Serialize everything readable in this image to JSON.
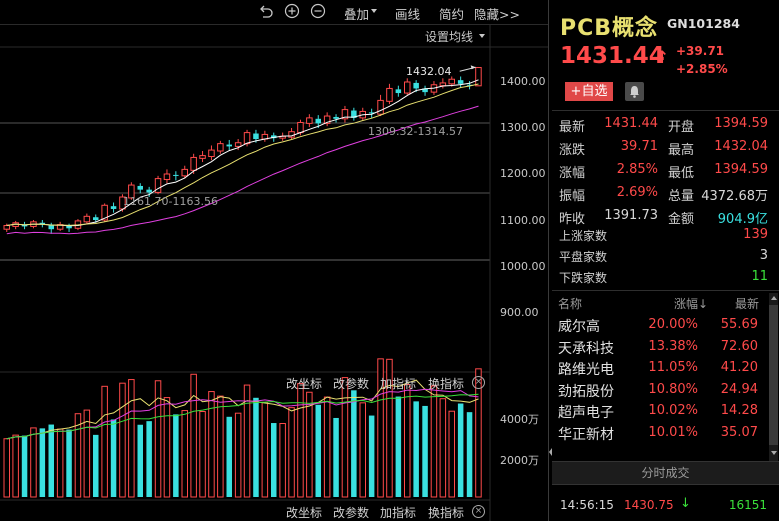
{
  "toolbar": {
    "items": [
      "叠加",
      "画线",
      "简约",
      "隐藏>>"
    ]
  },
  "chart": {
    "settings_label": "设置均线",
    "price_ticks": [
      "1400.00",
      "1300.00",
      "1200.00",
      "1100.00",
      "1000.00",
      "900.00"
    ],
    "volume_ticks": [
      "4000万",
      "2000万"
    ],
    "high_label": "1432.04",
    "range_label_1": "1309.32-1314.57",
    "range_label_2": "1161.70-1163.56",
    "indicator_buttons": [
      "改坐标",
      "改参数",
      "加指标",
      "换指标"
    ],
    "colors": {
      "up": "#ff4a4a",
      "down": "#3ae0e0",
      "ma5": "#ffffff",
      "ma10": "#e8e070",
      "ma20": "#e040e0",
      "ma_vol2": "#3ae03a"
    }
  },
  "chart_data": {
    "type": "candlestick",
    "price_axis": [
      900,
      1000,
      1100,
      1200,
      1300,
      1400
    ],
    "candles": [
      [
        1080,
        1088,
        1074,
        1092
      ],
      [
        1086,
        1094,
        1080,
        1098
      ],
      [
        1090,
        1086,
        1080,
        1096
      ],
      [
        1086,
        1096,
        1082,
        1100
      ],
      [
        1094,
        1090,
        1084,
        1100
      ],
      [
        1090,
        1080,
        1070,
        1094
      ],
      [
        1080,
        1090,
        1076,
        1096
      ],
      [
        1088,
        1082,
        1074,
        1092
      ],
      [
        1082,
        1098,
        1078,
        1102
      ],
      [
        1096,
        1108,
        1090,
        1114
      ],
      [
        1106,
        1100,
        1094,
        1112
      ],
      [
        1100,
        1132,
        1096,
        1136
      ],
      [
        1130,
        1124,
        1116,
        1138
      ],
      [
        1124,
        1150,
        1118,
        1156
      ],
      [
        1148,
        1176,
        1144,
        1182
      ],
      [
        1174,
        1166,
        1158,
        1180
      ],
      [
        1166,
        1160,
        1150,
        1172
      ],
      [
        1160,
        1190,
        1156,
        1196
      ],
      [
        1188,
        1200,
        1180,
        1210
      ],
      [
        1198,
        1196,
        1186,
        1206
      ],
      [
        1196,
        1210,
        1190,
        1218
      ],
      [
        1208,
        1236,
        1200,
        1244
      ],
      [
        1234,
        1240,
        1226,
        1250
      ],
      [
        1238,
        1252,
        1230,
        1262
      ],
      [
        1250,
        1266,
        1244,
        1272
      ],
      [
        1264,
        1260,
        1250,
        1274
      ],
      [
        1260,
        1268,
        1252,
        1276
      ],
      [
        1266,
        1290,
        1260,
        1296
      ],
      [
        1288,
        1276,
        1268,
        1296
      ],
      [
        1276,
        1286,
        1270,
        1294
      ],
      [
        1284,
        1278,
        1270,
        1290
      ],
      [
        1278,
        1282,
        1272,
        1290
      ],
      [
        1280,
        1292,
        1276,
        1300
      ],
      [
        1290,
        1312,
        1284,
        1318
      ],
      [
        1310,
        1322,
        1302,
        1330
      ],
      [
        1320,
        1310,
        1300,
        1328
      ],
      [
        1310,
        1326,
        1304,
        1334
      ],
      [
        1324,
        1320,
        1312,
        1330
      ],
      [
        1320,
        1340,
        1312,
        1348
      ],
      [
        1338,
        1322,
        1316,
        1344
      ],
      [
        1322,
        1336,
        1316,
        1344
      ],
      [
        1334,
        1332,
        1322,
        1342
      ],
      [
        1330,
        1360,
        1326,
        1372
      ],
      [
        1358,
        1386,
        1352,
        1396
      ],
      [
        1384,
        1376,
        1368,
        1392
      ],
      [
        1376,
        1400,
        1372,
        1408
      ],
      [
        1398,
        1386,
        1378,
        1404
      ],
      [
        1386,
        1378,
        1370,
        1392
      ],
      [
        1378,
        1394,
        1372,
        1402
      ],
      [
        1392,
        1398,
        1386,
        1408
      ],
      [
        1396,
        1406,
        1390,
        1412
      ],
      [
        1404,
        1396,
        1388,
        1412
      ],
      [
        1394,
        1392,
        1384,
        1402
      ],
      [
        1391.73,
        1431.44,
        1394.59,
        1432.04
      ]
    ],
    "volume_axis": [
      2000,
      4000
    ],
    "volume_unit": "万",
    "latest": {
      "open": 1394.59,
      "close": 1431.44,
      "low": 1394.59,
      "high": 1432.04
    },
    "annotated_high": 1432.04,
    "ranges": [
      [
        1309.32,
        1314.57
      ],
      [
        1161.7,
        1163.56
      ]
    ]
  },
  "quote": {
    "name": "PCB概念",
    "code": "GN101284",
    "price": "1431.44",
    "change": "+39.71",
    "change_pct": "+2.85%",
    "fav_label": "+自选",
    "rows": [
      {
        "l1": "最新",
        "v1": "1431.44",
        "c1": "red",
        "l2": "开盘",
        "v2": "1394.59",
        "c2": "red"
      },
      {
        "l1": "涨跌",
        "v1": "39.71",
        "c1": "red",
        "l2": "最高",
        "v2": "1432.04",
        "c2": "red"
      },
      {
        "l1": "涨幅",
        "v1": "2.85%",
        "c1": "red",
        "l2": "最低",
        "v2": "1394.59",
        "c2": "red"
      },
      {
        "l1": "振幅",
        "v1": "2.69%",
        "c1": "red",
        "l2": "总量",
        "v2": "4372.68万",
        "c2": "white"
      },
      {
        "l1": "昨收",
        "v1": "1391.73",
        "c1": "white",
        "l2": "金额",
        "v2": "904.9亿",
        "c2": "cyan"
      }
    ],
    "breadth": [
      {
        "label": "上涨家数",
        "value": "139",
        "color": "red"
      },
      {
        "label": "平盘家数",
        "value": "3",
        "color": "white"
      },
      {
        "label": "下跌家数",
        "value": "11",
        "color": "green"
      }
    ]
  },
  "members": {
    "headers": {
      "name": "名称",
      "pct": "涨幅↓",
      "price": "最新"
    },
    "rows": [
      {
        "name": "威尔高",
        "pct": "20.00%",
        "price": "55.69"
      },
      {
        "name": "天承科技",
        "pct": "13.38%",
        "price": "72.60"
      },
      {
        "name": "路维光电",
        "pct": "11.05%",
        "price": "41.20"
      },
      {
        "name": "劲拓股份",
        "pct": "10.80%",
        "price": "24.94"
      },
      {
        "name": "超声电子",
        "pct": "10.02%",
        "price": "14.28"
      },
      {
        "name": "华正新材",
        "pct": "10.01%",
        "price": "35.07"
      }
    ]
  },
  "ticks": {
    "title": "分时成交",
    "rows": [
      {
        "time": "14:56:15",
        "price": "1430.75",
        "dir": "↓",
        "vol": "16151"
      }
    ]
  }
}
